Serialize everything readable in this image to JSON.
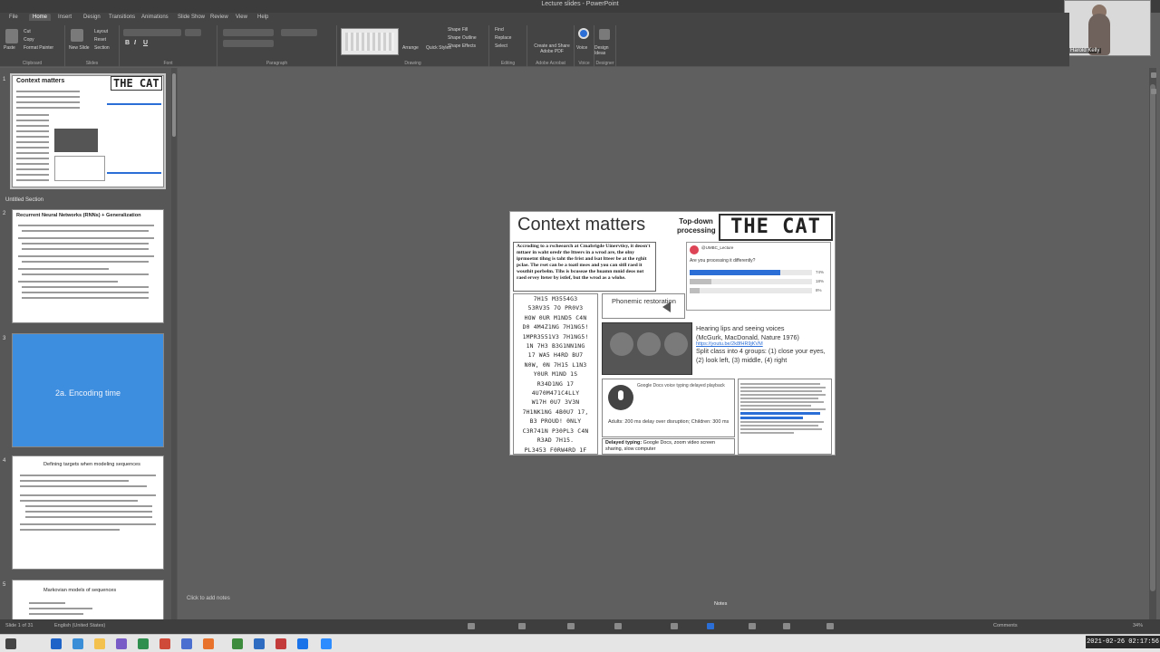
{
  "window": {
    "title": "Lecture slides - PowerPoint"
  },
  "webcam": {
    "name": "Harold Kelly"
  },
  "ribbon": {
    "tabs": [
      "File",
      "Home",
      "Insert",
      "Design",
      "Transitions",
      "Animations",
      "Slide Show",
      "Review",
      "View",
      "Help"
    ],
    "active_tab": "Home",
    "clipboard": {
      "paste": "Paste",
      "cut": "Cut",
      "copy": "Copy",
      "format_painter": "Format Painter",
      "group": "Clipboard"
    },
    "slides": {
      "new_slide": "New Slide",
      "layout": "Layout",
      "reset": "Reset",
      "section": "Section",
      "group": "Slides"
    },
    "font": {
      "bold": "B",
      "italic": "I",
      "underline": "U",
      "group": "Font"
    },
    "paragraph": {
      "group": "Paragraph"
    },
    "drawing": {
      "arrange": "Arrange",
      "quick_styles": "Quick Styles",
      "shape_fill": "Shape Fill",
      "shape_outline": "Shape Outline",
      "shape_effects": "Shape Effects",
      "group": "Drawing"
    },
    "editing": {
      "find": "Find",
      "replace": "Replace",
      "select": "Select",
      "group": "Editing"
    },
    "acrobat": {
      "create_share": "Create and Share Adobe PDF",
      "group": "Adobe Acrobat"
    },
    "voice": {
      "dictate": "Voice",
      "group": "Voice"
    },
    "ideas": {
      "label": "Design Ideas",
      "group": "Designer"
    }
  },
  "sidebar": {
    "slides": [
      {
        "number": "1",
        "title": "Context matters",
        "cat": "THE CAT",
        "kind": "thumbnail"
      },
      {
        "number": "",
        "section": "Untitled Section"
      },
      {
        "number": "2",
        "title": "Recurrent Neural Networks (RNNs) + Generalization",
        "kind": "text"
      },
      {
        "number": "3",
        "title": "2a. Encoding time",
        "kind": "blue"
      },
      {
        "number": "4",
        "title": "Defining targets when modeling sequences",
        "kind": "text"
      },
      {
        "number": "5",
        "title": "Markovian models of sequences",
        "kind": "text"
      }
    ]
  },
  "slide": {
    "title": "Context matters",
    "top_down": "Top-down processing",
    "cat": "THE CAT",
    "paragraph": "Accroding to a rscheearch at Cmabrigde Uinervtisy, it deosn't mttaer in waht oredr the ltteers in a wrod are, the olny iprmoetnt tihng is taht the frist and lsat ltteer be at the rghit pclae. The rset can be a toatl mses and you can sitll raed it wouthit porbelm. Tihs is bcuseae the huamn mnid deos not raed ervey lteter by istlef, but the wrod as a wlohe.",
    "poll": {
      "user": "@UMBC_Lecture",
      "question": "Are you processing it differently?",
      "options": [
        {
          "label": "Yes",
          "pct": 74
        },
        {
          "label": "No",
          "pct": 18
        },
        {
          "label": "Unsure",
          "pct": 8
        }
      ]
    },
    "leet_lines": [
      "7H15 M3554G3",
      "53RV35 7O PR0V3",
      "HOW 0UR M1ND5 C4N",
      "D0 4M4Z1NG 7H1NG5!",
      "1MPR3551V3 7H1NG5!",
      "1N 7H3 B3G1NN1NG",
      "17 WA5 H4RD BU7",
      "N0W, 0N 7H15 L1N3",
      "Y0UR M1ND 1S",
      "R34D1NG 17",
      "4U70M471C4LLY",
      "W17H 0U7 3V3N",
      "7H1NK1NG 4B0U7 17,",
      "B3 PROUD! 0NLY",
      "C3R741N P30PL3 C4N",
      "R3AD 7H15.",
      "PL3453 F0RW4RD 1F",
      "U C4N R34D 7H15."
    ],
    "phonemic": "Phonemic restoration",
    "mcgurk": {
      "heading": "Hearing lips and seeing voices",
      "citation": "(McGurk, MacDonald, Nature 1976)",
      "link": "https://youtu.be/2k8fHR9jKVM",
      "body": "Split class into 4 groups: (1) close your eyes, (2) look left, (3) middle, (4) right"
    },
    "speech": {
      "caption": "Google Docs voice typing delayed playback",
      "adults": "Adults: 200 ms delay over disruption; Children: 300 ms"
    },
    "delayed": {
      "label": "Delayed typing:",
      "text": "Google Docs, zoom video screen sharing, slow computer"
    }
  },
  "notes_placeholder": "Click to add notes",
  "status": {
    "slide_indicator": "Slide 1 of 31",
    "language": "English (United States)",
    "notes": "Notes",
    "comments": "Comments",
    "zoom": "34%"
  },
  "taskbar": {
    "clock": "2021-02-26 02:17:56"
  },
  "colors": {
    "accent": "#2b6fd6",
    "blue_slide": "#3e8ee0",
    "canvas": "#5f5f5f"
  }
}
